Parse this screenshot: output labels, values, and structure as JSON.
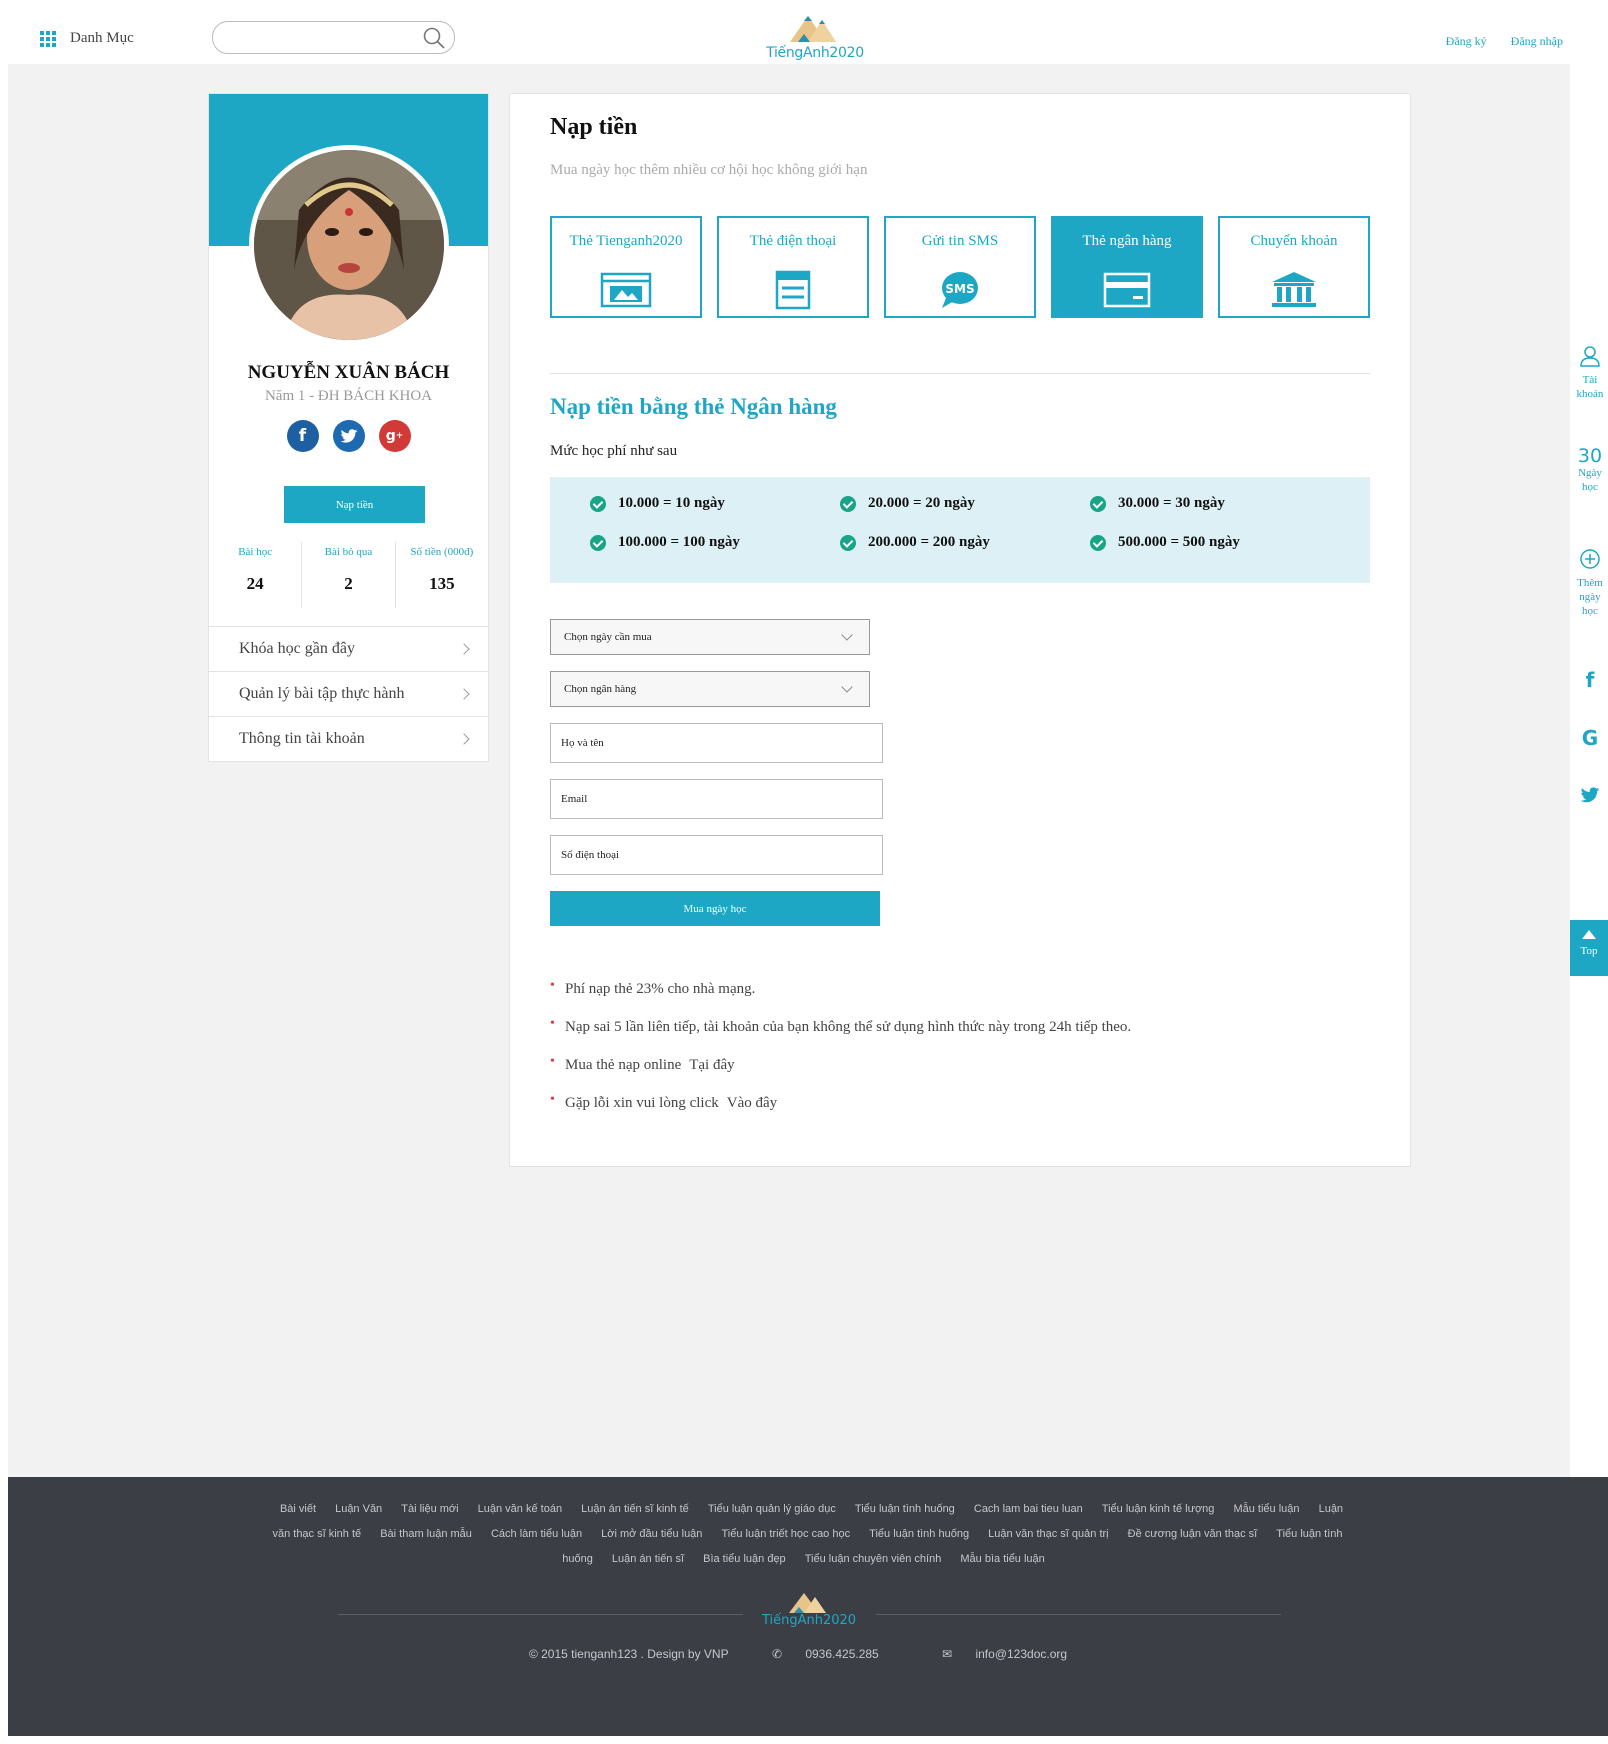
{
  "header": {
    "menu_label": "Danh Mục",
    "search_placeholder": "",
    "logo_text": "TiếngAnh2020",
    "register": "Đăng ký",
    "login": "Đăng nhập"
  },
  "profile": {
    "name": "NGUYỄN XUÂN BÁCH",
    "subtitle": "Năm 1 - ĐH BÁCH KHOA",
    "socials": [
      "f",
      "t",
      "g+"
    ],
    "topup_button": "Nạp tiền",
    "stats": [
      {
        "label": "Bài học",
        "value": "24"
      },
      {
        "label": "Bài bỏ qua",
        "value": "2"
      },
      {
        "label": "Số tiền (000đ)",
        "value": "135"
      }
    ],
    "menu": [
      "Khóa học gần đây",
      "Quản lý bài tập thực hành",
      "Thông tin tài khoản"
    ]
  },
  "main": {
    "title": "Nạp tiền",
    "subtitle": "Mua ngày học thêm nhiều cơ hội học không giới hạn",
    "methods": [
      {
        "label": "Thẻ Tienganh2020",
        "icon": "card-image-icon",
        "active": false
      },
      {
        "label": "Thẻ điện thoại",
        "icon": "phone-card-icon",
        "active": false
      },
      {
        "label": "Gửi tin SMS",
        "icon": "sms-icon",
        "active": false
      },
      {
        "label": "Thẻ ngân hàng",
        "icon": "bank-card-icon",
        "active": true
      },
      {
        "label": "Chuyển khoản",
        "icon": "bank-building-icon",
        "active": false
      }
    ],
    "section_title": "Nạp tiền bằng thẻ Ngân hàng",
    "price_note": "Mức học phí như sau",
    "prices": [
      "10.000 = 10 ngày",
      "20.000 = 20 ngày",
      "30.000 = 30 ngày",
      "100.000 = 100 ngày",
      "200.000 = 200 ngày",
      "500.000 = 500 ngày"
    ],
    "select_days": "Chọn ngày cần mua",
    "select_bank": "Chọn ngân hàng",
    "field_name": "Họ và tên",
    "field_email": "Email",
    "field_phone": "Số điện thoại",
    "buy_button": "Mua ngày học",
    "notes": [
      {
        "text": "Phí nạp thẻ 23% cho nhà mạng.",
        "link": ""
      },
      {
        "text": "Nạp sai 5 lần liên tiếp, tài khoản của bạn không thể sử dụng hình thức này trong 24h tiếp theo.",
        "link": ""
      },
      {
        "text": "Mua thẻ nạp online",
        "link": "Tại đây"
      },
      {
        "text": "Gặp lỗi xin vui lòng click",
        "link": "Vào đây"
      }
    ]
  },
  "right_sidebar": {
    "account": "Tài khoản",
    "days_count": "30",
    "days_label": "Ngày học",
    "add_days": "Thêm ngày học",
    "top": "Top"
  },
  "footer": {
    "links": [
      "Bài viết",
      "Luận Văn",
      "Tài liệu mới",
      "Luận văn kế toán",
      "Luận án tiến sĩ kinh tế",
      "Tiểu luận quản lý giáo dục",
      "Tiểu luận tình huống",
      "Cach lam bai tieu luan",
      "Tiểu luận kinh tế lượng",
      "Mẫu tiểu luận",
      "Luận văn thạc sĩ kinh tế",
      "Bài tham luận mẫu",
      "Cách làm tiểu luận",
      "Lời mở đầu tiểu luận",
      "Tiểu luận triết học cao học",
      "Tiểu luận tình huống",
      "Luận văn thạc sĩ quản trị",
      "Đề cương luận văn thạc sĩ",
      "Tiểu luận tình huống",
      "Luận án tiến sĩ",
      "Bìa tiểu luận đẹp",
      "Tiểu luận chuyên viên chính",
      "Mẫu bìa tiểu luận"
    ],
    "logo_text": "TiếngAnh2020",
    "copyright": "© 2015  tienganh123 . Design by VNP",
    "phone": "0936.425.285",
    "email": "info@123doc.org"
  },
  "colors": {
    "accent": "#1ea7c5",
    "price_box": "#dcf0f5",
    "check": "#19a487",
    "footer_bg": "#3b3e45",
    "page_bg": "#f2f2f2"
  }
}
